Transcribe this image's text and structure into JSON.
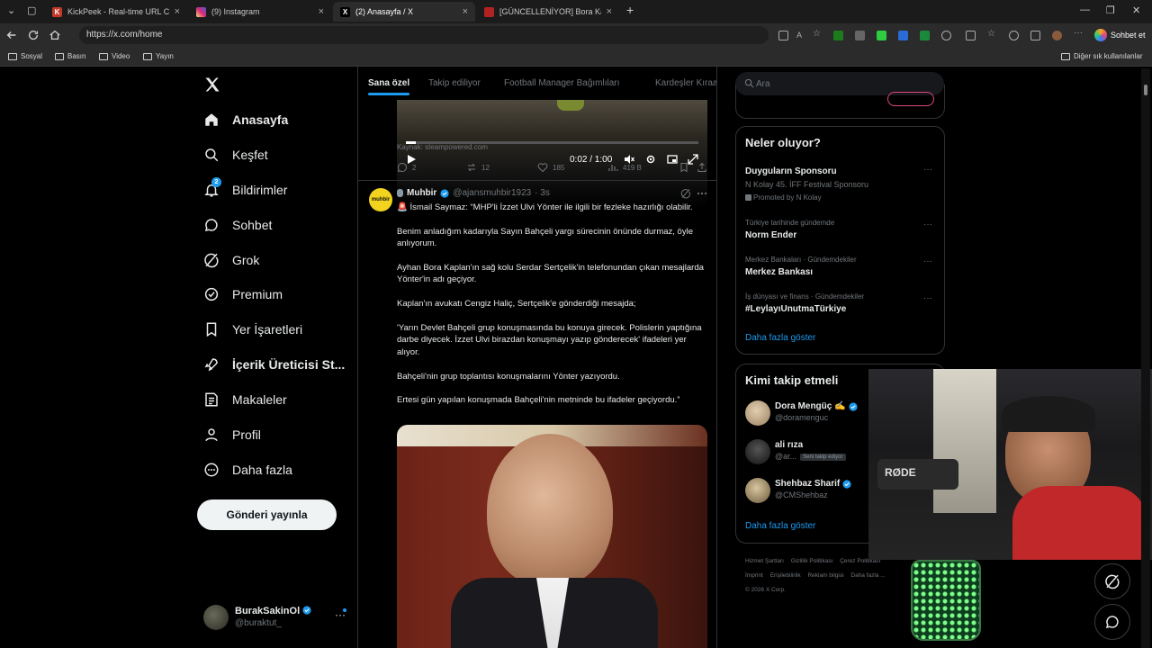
{
  "browser": {
    "tabs": [
      {
        "title": "KickPeek - Real-time URL Crawler",
        "favicon": "kick-favicon",
        "color": "#c0392b"
      },
      {
        "title": "(9) Instagram",
        "favicon": "instagram-favicon",
        "color": "#d62976"
      },
      {
        "title": "(2) Anasayfa / X",
        "favicon": "x-favicon",
        "color": "#000000",
        "active": true
      },
      {
        "title": "[GÜNCELLENİYOR] Bora Kaplan Dav",
        "favicon": "news-favicon",
        "color": "#b22222"
      }
    ],
    "url": "https://x.com/home",
    "chat_button": "Sohbet et",
    "bookmarks": [
      "Sosyal",
      "Basın",
      "Video",
      "Yayın"
    ],
    "other_bookmarks": "Diğer sık kullanılanlar"
  },
  "nav": {
    "items": [
      {
        "label": "Anasayfa",
        "icon": "home-icon"
      },
      {
        "label": "Keşfet",
        "icon": "search-icon"
      },
      {
        "label": "Bildirimler",
        "icon": "bell-icon",
        "badge": "2"
      },
      {
        "label": "Sohbet",
        "icon": "chat-icon"
      },
      {
        "label": "Grok",
        "icon": "grok-icon"
      },
      {
        "label": "Premium",
        "icon": "premium-icon"
      },
      {
        "label": "Yer İşaretleri",
        "icon": "bookmark-icon"
      },
      {
        "label": "İçerik Üreticisi St...",
        "icon": "rocket-icon"
      },
      {
        "label": "Makaleler",
        "icon": "article-icon"
      },
      {
        "label": "Profil",
        "icon": "profile-icon"
      },
      {
        "label": "Daha fazla",
        "icon": "more-circle-icon"
      }
    ],
    "post_button": "Gönderi yayınla",
    "account": {
      "name": "BurakSakinOl",
      "handle": "@buraktut_"
    }
  },
  "timeline": {
    "tabs": [
      "Sana özel",
      "Takip ediliyor",
      "Football Manager Bağımlıları",
      "Kardeşler Kıraathanesi"
    ],
    "video": {
      "time": "0:02 / 1:00",
      "progress": 0.033,
      "source": "Kaynak: steampowered.com"
    },
    "prev_actions": {
      "replies": "2",
      "reposts": "12",
      "likes": "185",
      "views": "419 B"
    },
    "tweet": {
      "name": "Muhbir",
      "handle": "@ajansmuhbir1923",
      "time": "· 3s",
      "avatar_text": "muhbir",
      "paragraphs": [
        "🚨 İsmail Saymaz: “MHP'li İzzet Ulvi Yönter ile ilgili bir fezleke hazırlığı olabilir.",
        "Benim anladığım kadarıyla Sayın Bahçeli yargı sürecinin önünde durmaz, öyle anlıyorum.",
        "Ayhan Bora Kaplan'ın sağ kolu Serdar Sertçelik'in telefonundan çıkan mesajlarda Yönter'in adı geçiyor.",
        "Kaplan'ın avukatı Cengiz Haliç, Sertçelik'e gönderdiği mesajda;",
        "'Yarın Devlet Bahçeli grup konuşmasında bu konuya girecek. Polislerin yaptığına darbe diyecek. İzzet Ulvi birazdan konuşmayı yazıp gönderecek' ifadeleri yer alıyor.",
        "Bahçeli'nin grup toplantısı konuşmalarını Yönter yazıyordu.",
        "Ertesi gün yapılan konuşmada Bahçeli'nin metninde bu ifadeler geçiyordu.”"
      ]
    }
  },
  "sidebar": {
    "search_placeholder": "Ara",
    "trends": {
      "title": "Neler oluyor?",
      "items": [
        {
          "context": "",
          "title": "Duyguların Sponsoru",
          "subtitle": "N Kolay 45. İFF Festival Sponsoru",
          "promoted": "Promoted by N Kolay"
        },
        {
          "context": "Türkiye tarihinde gündemde",
          "title": "Norm Ender"
        },
        {
          "context": "Merkez Bankaları · Gündemdekiler",
          "title": "Merkez Bankası"
        },
        {
          "context": "İş dünyası ve finans · Gündemdekiler",
          "title": "#LeylayıUnutmaTürkiye"
        }
      ],
      "show_more": "Daha fazla göster"
    },
    "who_to_follow": {
      "title": "Kimi takip etmeli",
      "items": [
        {
          "name": "Dora Mengüç ✍️",
          "handle": "@doramenguc",
          "verified": true,
          "color": "#c9b79c"
        },
        {
          "name": "ali rıza",
          "handle": "@ar...",
          "badge": "Seni takip ediyor",
          "verified": false,
          "color": "#2a2a2a"
        },
        {
          "name": "Shehbaz Sharif",
          "handle": "@CMShehbaz",
          "verified": true,
          "color": "#b9a07a"
        }
      ],
      "show_more": "Daha fazla göster"
    },
    "footer": [
      "Hizmet Şartları",
      "Gizlilik Politikası",
      "Çerez Politikası",
      "İmprint",
      "Erişilebilirlik",
      "Reklam bilgisi",
      "Daha fazla ...",
      "© 2026 X Corp."
    ]
  },
  "webcam": {
    "mic_label": "RØDE"
  },
  "colors": {
    "accent": "#1d9bf0",
    "bg": "#000000",
    "border": "#2f3336"
  }
}
